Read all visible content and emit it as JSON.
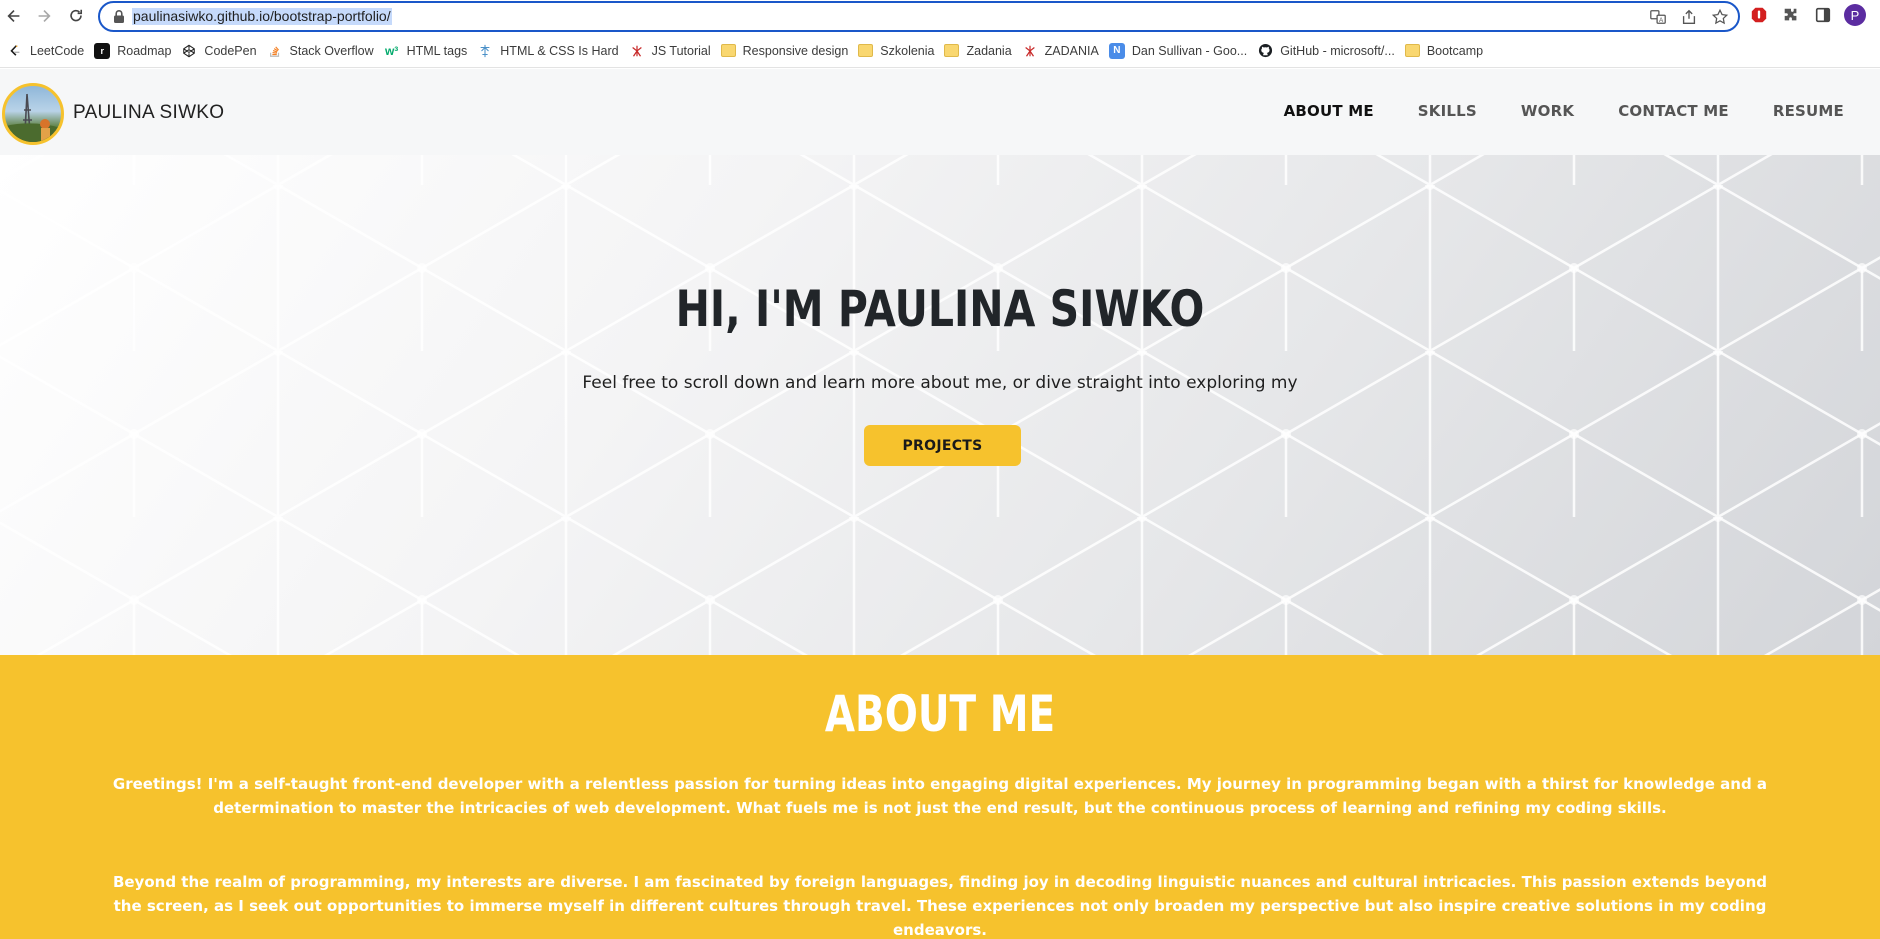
{
  "browser": {
    "url": "paulinasiwko.github.io/bootstrap-portfolio/",
    "profile_initial": "P",
    "bookmarks": [
      {
        "label": "LeetCode",
        "icon": "leetcode-icon"
      },
      {
        "label": "Roadmap",
        "icon": "roadmap-icon"
      },
      {
        "label": "CodePen",
        "icon": "codepen-icon"
      },
      {
        "label": "Stack Overflow",
        "icon": "stackoverflow-icon"
      },
      {
        "label": "HTML tags",
        "icon": "w3schools-icon"
      },
      {
        "label": "HTML & CSS Is Hard",
        "icon": "html-css-is-hard-icon"
      },
      {
        "label": "JS Tutorial",
        "icon": "js-tutorial-icon"
      },
      {
        "label": "Responsive design",
        "icon": "folder-icon"
      },
      {
        "label": "Szkolenia",
        "icon": "folder-icon"
      },
      {
        "label": "Zadania",
        "icon": "folder-icon"
      },
      {
        "label": "ZADANIA",
        "icon": "zadania-icon"
      },
      {
        "label": "Dan Sullivan - Goo...",
        "icon": "notion-icon"
      },
      {
        "label": "GitHub - microsoft/...",
        "icon": "github-icon"
      },
      {
        "label": "Bootcamp",
        "icon": "folder-icon"
      }
    ]
  },
  "site": {
    "brand": "PAULINA SIWKO",
    "nav": [
      {
        "label": "ABOUT ME",
        "active": true
      },
      {
        "label": "SKILLS",
        "active": false
      },
      {
        "label": "WORK",
        "active": false
      },
      {
        "label": "CONTACT ME",
        "active": false
      },
      {
        "label": "RESUME",
        "active": false
      }
    ],
    "accent_color": "#f6c22d"
  },
  "hero": {
    "title": "HI, I'M PAULINA SIWKO",
    "subtitle": "Feel free to scroll down and learn more about me, or dive straight into exploring my",
    "cta_label": "PROJECTS"
  },
  "about": {
    "title": "ABOUT ME",
    "paragraphs": [
      "Greetings! I'm a self-taught front-end developer with a relentless passion for turning ideas into engaging digital experiences. My journey in programming began with a thirst for knowledge and a determination to master the intricacies of web development. What fuels me is not just the end result, but the continuous process of learning and refining my coding skills.",
      "Beyond the realm of programming, my interests are diverse. I am fascinated by foreign languages, finding joy in decoding linguistic nuances and cultural intricacies. This passion extends beyond the screen, as I seek out opportunities to immerse myself in different cultures through travel. These experiences not only broaden my perspective but also inspire creative solutions in my coding endeavors."
    ]
  }
}
